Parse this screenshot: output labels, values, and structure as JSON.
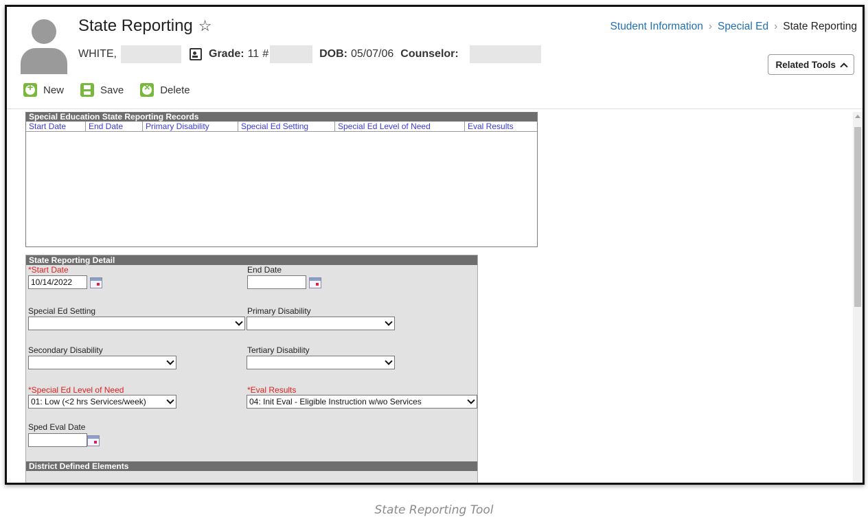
{
  "header": {
    "title": "State Reporting",
    "student_last": "WHITE,",
    "grade_label": "Grade:",
    "grade_value": "11",
    "number_sign": "#",
    "dob_label": "DOB:",
    "dob_value": "05/07/06",
    "counselor_label": "Counselor:",
    "related_tools": "Related Tools"
  },
  "breadcrumb": {
    "items": [
      "Student Information",
      "Special Ed",
      "State Reporting"
    ]
  },
  "toolbar": {
    "new_label": "New",
    "save_label": "Save",
    "delete_label": "Delete"
  },
  "records": {
    "title": "Special Education State Reporting Records",
    "columns": [
      "Start Date",
      "End Date",
      "Primary Disability",
      "Special Ed Setting",
      "Special Ed Level of Need",
      "Eval Results"
    ]
  },
  "detail": {
    "title": "State Reporting Detail",
    "start_date_label": "*Start Date",
    "start_date_value": "10/14/2022",
    "end_date_label": "End Date",
    "end_date_value": "",
    "setting_label": "Special Ed Setting",
    "setting_value": "",
    "primary_label": "Primary Disability",
    "primary_value": "",
    "secondary_label": "Secondary Disability",
    "secondary_value": "",
    "tertiary_label": "Tertiary Disability",
    "tertiary_value": "",
    "level_label": "*Special Ed Level of Need",
    "level_value": "01: Low (<2 hrs Services/week)",
    "eval_label": "*Eval Results",
    "eval_value": "04: Init Eval - Eligible Instruction w/wo Services",
    "sped_eval_label": "Sped Eval Date",
    "sped_eval_value": "",
    "district_title": "District Defined Elements"
  },
  "caption": "State Reporting Tool",
  "colors": {
    "accent_green": "#79b83c",
    "link_blue": "#1f6fb2",
    "required_red": "#e02020",
    "panel_header": "#6e6e6e"
  },
  "icons": [
    "avatar",
    "star-icon",
    "id-card-icon",
    "chevron-up-icon",
    "plus-circle-icon",
    "save-icon",
    "delete-icon",
    "calendar-icon",
    "chevron-down-icon"
  ]
}
